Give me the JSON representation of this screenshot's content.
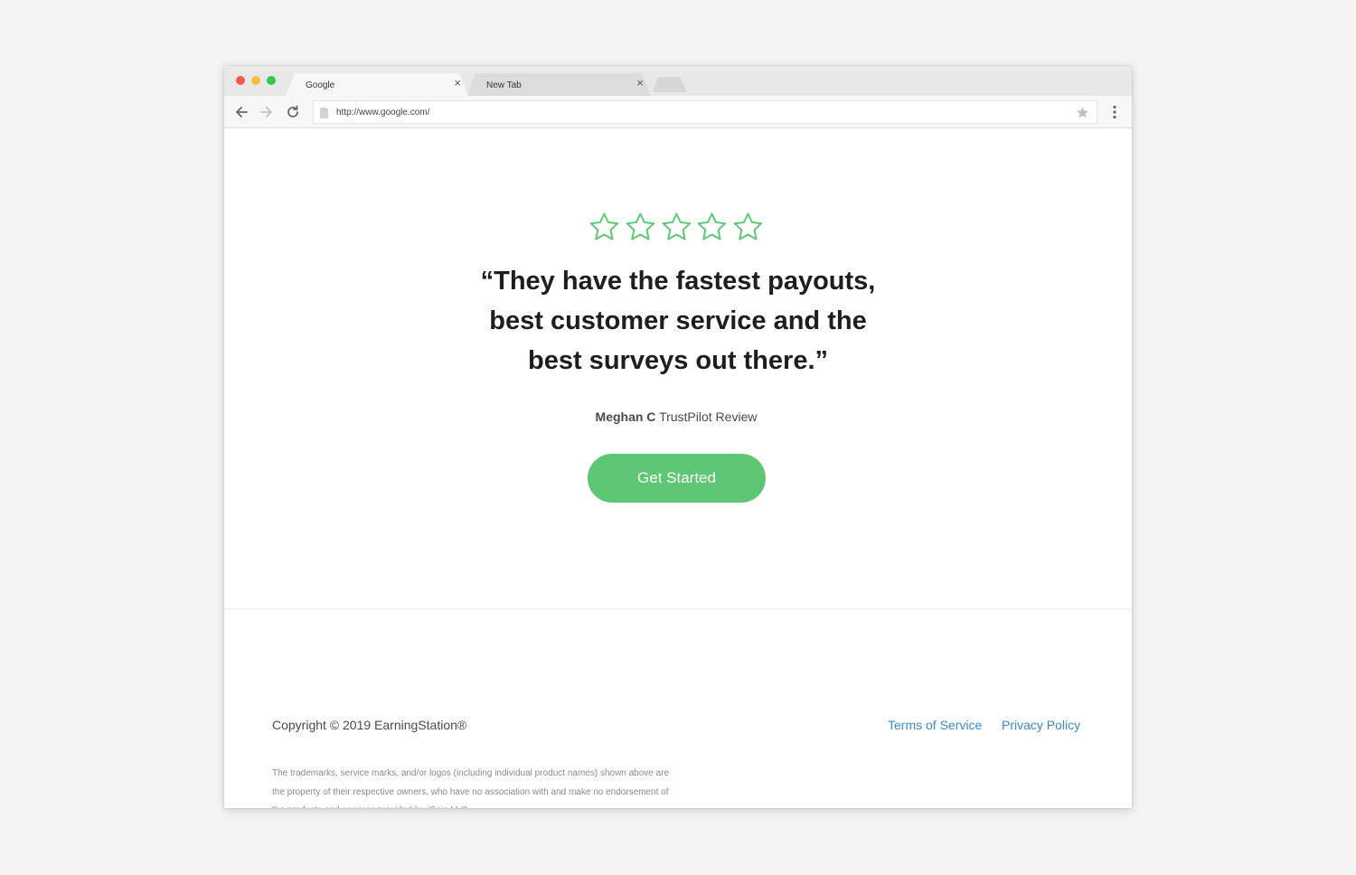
{
  "browser": {
    "tabs": [
      {
        "label": "Google",
        "active": true
      },
      {
        "label": "New Tab",
        "active": false
      }
    ],
    "tab_close_glyph": "×",
    "url": "http://www.google.com/",
    "icons": [
      "back-arrow-icon",
      "forward-arrow-icon",
      "reload-icon",
      "page-icon",
      "bookmark-star-icon",
      "more-vertical-icon"
    ]
  },
  "review": {
    "rating": 5,
    "rating_max": 5,
    "star_color": "#5ec774",
    "quote_lines": [
      "“They have the fastest payouts,",
      "best customer service and the",
      "best surveys out there.”"
    ],
    "reviewer_name": "Meghan C",
    "reviewer_source": "TrustPilot Review"
  },
  "cta": {
    "label": "Get Started",
    "color": "#5ec774"
  },
  "footer": {
    "copyright": "Copyright © 2019 EarningStation®",
    "links": [
      {
        "label": "Terms of Service"
      },
      {
        "label": "Privacy Policy"
      }
    ],
    "link_color": "#3a8ad0",
    "disclaimer": "The trademarks, service marks, and/or logos (including individual product names) shown above are the property of their respective owners, who have no association with and make no endorsement of the products and services provided by iGain LLC."
  }
}
